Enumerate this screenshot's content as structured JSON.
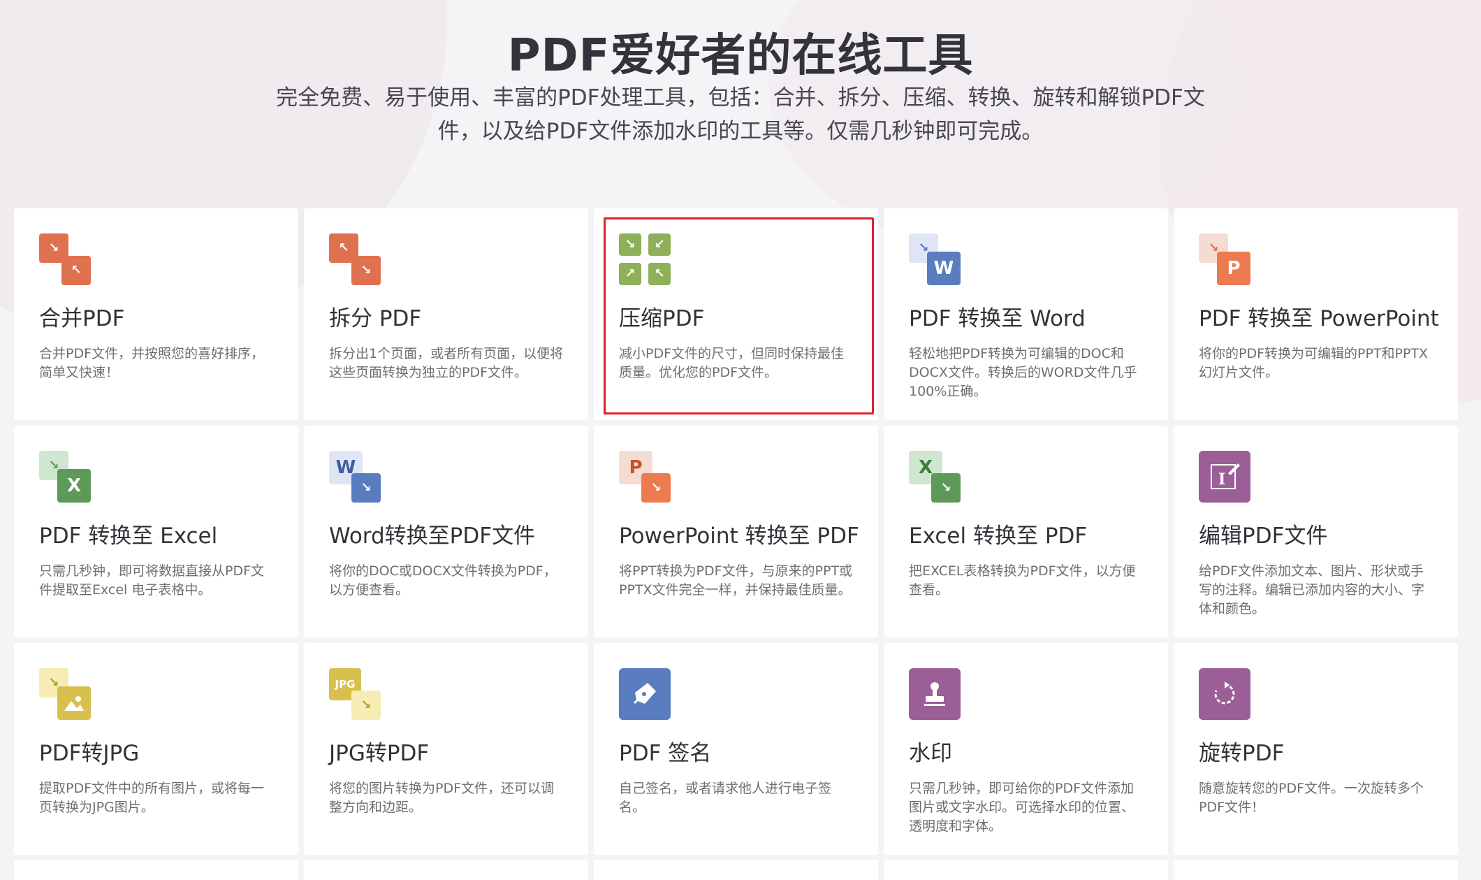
{
  "hero": {
    "title": "PDF爱好者的在线工具",
    "subtitle_line1": "完全免费、易于使用、丰富的PDF处理工具，包括：合并、拆分、压缩、转换、旋转和解锁PDF文",
    "subtitle_line2": "件，以及给PDF文件添加水印的工具等。仅需几秒钟即可完成。"
  },
  "tools": [
    {
      "title": "合并PDF",
      "desc": "合并PDF文件，并按照您的喜好排序，简单又快速！",
      "icon": "merge-icon"
    },
    {
      "title": "拆分 PDF",
      "desc": "拆分出1个页面，或者所有页面，以便将这些页面转换为独立的PDF文件。",
      "icon": "split-icon"
    },
    {
      "title": "压缩PDF",
      "desc": "减小PDF文件的尺寸，但同时保持最佳质量。优化您的PDF文件。",
      "icon": "compress-icon"
    },
    {
      "title": "PDF 转换至 Word",
      "desc": "轻松地把PDF转换为可编辑的DOC和DOCX文件。转换后的WORD文件几乎100%正确。",
      "icon": "pdf-to-word-icon"
    },
    {
      "title": "PDF 转换至 PowerPoint",
      "desc": "将你的PDF转换为可编辑的PPT和PPTX幻灯片文件。",
      "icon": "pdf-to-powerpoint-icon"
    },
    {
      "title": "PDF 转换至 Excel",
      "desc": "只需几秒钟，即可将数据直接从PDF文件提取至Excel 电子表格中。",
      "icon": "pdf-to-excel-icon"
    },
    {
      "title": "Word转换至PDF文件",
      "desc": "将你的DOC或DOCX文件转换为PDF，以方便查看。",
      "icon": "word-to-pdf-icon"
    },
    {
      "title": "PowerPoint 转换至 PDF",
      "desc": "将PPT转换为PDF文件，与原来的PPT或PPTX文件完全一样，并保持最佳质量。",
      "icon": "powerpoint-to-pdf-icon"
    },
    {
      "title": "Excel 转换至 PDF",
      "desc": "把EXCEL表格转换为PDF文件，以方便查看。",
      "icon": "excel-to-pdf-icon"
    },
    {
      "title": "编辑PDF文件",
      "desc": "给PDF文件添加文本、图片、形状或手写的注释。编辑已添加内容的大小、字体和颜色。",
      "icon": "edit-pdf-icon"
    },
    {
      "title": "PDF转JPG",
      "desc": "提取PDF文件中的所有图片，或将每一页转换为JPG图片。",
      "icon": "pdf-to-jpg-icon"
    },
    {
      "title": "JPG转PDF",
      "desc": "将您的图片转换为PDF文件，还可以调整方向和边距。",
      "icon": "jpg-to-pdf-icon"
    },
    {
      "title": "PDF 签名",
      "desc": "自己签名，或者请求他人进行电子签名。",
      "icon": "sign-pdf-icon"
    },
    {
      "title": "水印",
      "desc": "只需几秒钟，即可给你的PDF文件添加图片或文字水印。可选择水印的位置、透明度和字体。",
      "icon": "watermark-icon"
    },
    {
      "title": "旋转PDF",
      "desc": "随意旋转您的PDF文件。一次旋转多个PDF文件！",
      "icon": "rotate-pdf-icon"
    }
  ],
  "icon_letters": {
    "word": "W",
    "powerpoint": "P",
    "excel": "X",
    "jpg": "JPG"
  },
  "colors": {
    "orange": "#e0714f",
    "green": "#8fb05a",
    "blue": "#5a7dbf",
    "excel_green": "#5d9a5a",
    "purple": "#9b5e96",
    "yellow": "#d8c04e",
    "selection": "#e0202c"
  },
  "selected_tool": "压缩PDF"
}
